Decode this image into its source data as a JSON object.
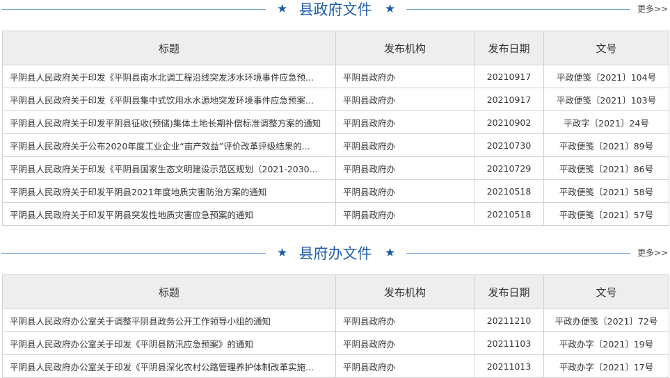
{
  "sections": [
    {
      "title": "县政府文件",
      "more": "更多>>",
      "columns": {
        "title": "标题",
        "org": "发布机构",
        "date": "发布日期",
        "num": "文号"
      },
      "rows": [
        {
          "title": "平阴县人民政府关于印发《平阴县南水北调工程沿线突发涉水环境事件应急预...",
          "org": "平阴县政府办",
          "date": "20210917",
          "num": "平政便笺〔2021〕104号"
        },
        {
          "title": "平阴县人民政府关于印发《平阴县集中式饮用水水源地突发环境事件应急预案...",
          "org": "平阴县政府办",
          "date": "20210917",
          "num": "平政便笺〔2021〕103号"
        },
        {
          "title": "平阴县人民政府关于印发平阴县征收(预储)集体土地长期补偿标准调整方案的通知",
          "org": "平阴县政府办",
          "date": "20210902",
          "num": "平政字〔2021〕24号"
        },
        {
          "title": "平阴县人民政府关于公布2020年度工业企业“亩产效益”评价改革评级结果的...",
          "org": "平阴县政府办",
          "date": "20210730",
          "num": "平政便笺〔2021〕89号"
        },
        {
          "title": "平阴县人民政府关于印发《平阴县国家生态文明建设示范区规划（2021-2030...",
          "org": "平阴县政府办",
          "date": "20210729",
          "num": "平政便笺〔2021〕86号"
        },
        {
          "title": "平阴县人民政府关于印发平阴县2021年度地质灾害防治方案的通知",
          "org": "平阴县政府办",
          "date": "20210518",
          "num": "平政便笺〔2021〕58号"
        },
        {
          "title": "平阴县人民政府关于印发平阴县突发性地质灾害应急预案的通知",
          "org": "平阴县政府办",
          "date": "20210518",
          "num": "平政便笺〔2021〕57号"
        }
      ]
    },
    {
      "title": "县府办文件",
      "more": "更多>>",
      "columns": {
        "title": "标题",
        "org": "发布机构",
        "date": "发布日期",
        "num": "文号"
      },
      "rows": [
        {
          "title": "平阴县人民政府办公室关于调整平阴县政务公开工作领导小组的通知",
          "org": "平阴县政府办",
          "date": "20211210",
          "num": "平政办便笺〔2021〕72号"
        },
        {
          "title": "平阴县人民政府办公室关于印发《平阴县防汛应急预案》的通知",
          "org": "平阴县政府办",
          "date": "20211103",
          "num": "平政办字〔2021〕19号"
        },
        {
          "title": "平阴县人民政府办公室关于印发《平阴县深化农村公路管理养护体制改革实施...",
          "org": "平阴县政府办",
          "date": "20211013",
          "num": "平政办字〔2021〕17号"
        }
      ]
    }
  ]
}
